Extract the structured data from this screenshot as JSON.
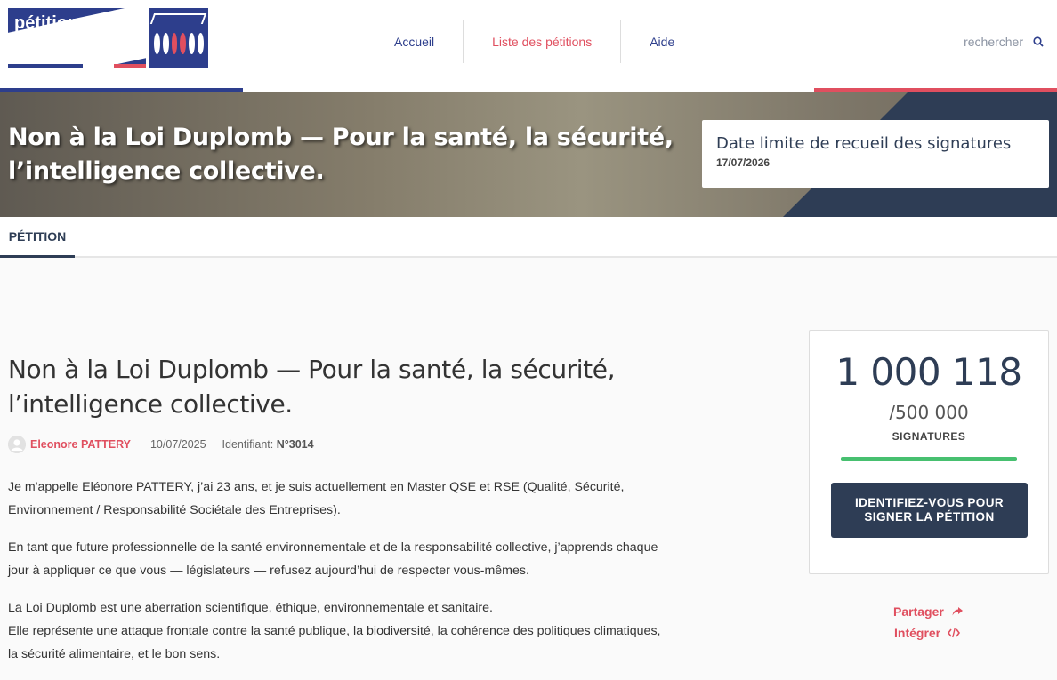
{
  "logo": {
    "text": "pétitions"
  },
  "nav": {
    "items": [
      "Accueil",
      "Liste des pétitions",
      "Aide"
    ],
    "active_index": 1
  },
  "search": {
    "placeholder": "rechercher"
  },
  "banner": {
    "title": "Non à la Loi Duplomb — Pour la santé, la sécurité, l’intelligence collective.",
    "deadline_label": "Date limite de recueil des signatures",
    "deadline_value": "17/07/2026"
  },
  "tabs": {
    "petition": "PÉTITION"
  },
  "petition": {
    "title": "Non à la Loi Duplomb — Pour la santé, la sécurité, l’intelligence collective.",
    "author": "Eleonore PATTERY",
    "date": "10/07/2025",
    "ident_label": "Identifiant:",
    "ident_value": "N°3014",
    "paragraphs": [
      "Je m'appelle Eléonore PATTERY, j’ai 23 ans, et je suis actuellement en Master QSE et RSE (Qualité, Sécurité, Environnement / Responsabilité Sociétale des Entreprises).",
      "En tant que future professionnelle de la santé environnementale et de la responsabilité collective, j’apprends chaque jour à appliquer ce que vous — législateurs — refusez aujourd’hui de respecter vous-mêmes.",
      "La Loi Duplomb est une aberration scientifique, éthique, environnementale et sanitaire.",
      "Elle représente une attaque frontale contre la santé publique, la biodiversité, la cohérence des politiques climatiques, la sécurité alimentaire, et le bon sens."
    ]
  },
  "signatures": {
    "count": "1 000 118",
    "goal": "/500 000",
    "label": "SIGNATURES",
    "progress_fraction": 1.0,
    "cta": "IDENTIFIEZ-VOUS POUR SIGNER LA PÉTITION"
  },
  "actions": {
    "share": "Partager",
    "embed": "Intégrer"
  },
  "colors": {
    "navy": "#2e3d55",
    "brand_blue": "#2d3e8c",
    "accent_red": "#e04f5f",
    "progress_green": "#47c070"
  }
}
